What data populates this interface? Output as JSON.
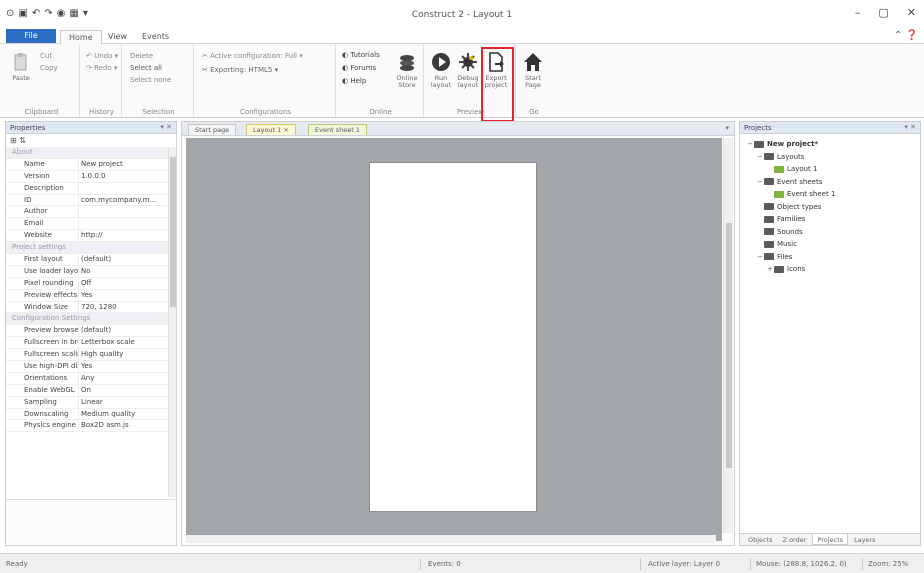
{
  "window": {
    "title": "Construct 2 - Layout 1",
    "controls": [
      "–",
      "▢",
      "✕"
    ]
  },
  "qat_icons": [
    "app-icon",
    "save-icon",
    "undo-icon",
    "redo-icon",
    "preview-icon",
    "settings-icon"
  ],
  "tabs": [
    {
      "label": "File"
    },
    {
      "label": "Home"
    },
    {
      "label": "View"
    },
    {
      "label": "Events"
    }
  ],
  "ribbon": {
    "clipboard": {
      "label": "Clipboard",
      "items": [
        "Paste",
        "Cut",
        "Copy",
        "Delete"
      ]
    },
    "history": {
      "label": "History",
      "items": [
        "Undo",
        "Redo"
      ]
    },
    "selection": {
      "label": "Selection",
      "items": [
        "Select all",
        "Select none"
      ]
    },
    "configurations": {
      "label": "Configurations",
      "items": [
        "Active configuration: Full",
        "Exporting: HTML5"
      ]
    },
    "online": {
      "label": "Online",
      "items": [
        "Tutorials",
        "Forums",
        "Help"
      ]
    },
    "store": {
      "label": "Online Store"
    },
    "preview": {
      "label": "Preview",
      "buttons": [
        {
          "label": "Run layout"
        },
        {
          "label": "Debug layout"
        },
        {
          "label": "Export project"
        }
      ]
    },
    "go": {
      "label": "Go",
      "buttons": [
        {
          "label": "Start Page"
        }
      ]
    }
  },
  "properties_panel": {
    "title": "Properties",
    "rows": [
      {
        "section": true,
        "key": "About"
      },
      {
        "key": "Name",
        "value": "New project"
      },
      {
        "key": "Version",
        "value": "1.0.0.0"
      },
      {
        "key": "Description",
        "value": ""
      },
      {
        "key": "ID",
        "value": "com.mycompany.m..."
      },
      {
        "key": "Author",
        "value": ""
      },
      {
        "key": "Email",
        "value": ""
      },
      {
        "key": "Website",
        "value": "http://"
      },
      {
        "section": true,
        "key": "Project settings"
      },
      {
        "key": "First layout",
        "value": "(default)"
      },
      {
        "key": "Use loader layout",
        "value": "No"
      },
      {
        "key": "Pixel rounding",
        "value": "Off"
      },
      {
        "key": "Preview effects",
        "value": "Yes"
      },
      {
        "key": "Window Size",
        "value": "720, 1280"
      },
      {
        "section": true,
        "key": "Configuration Settings"
      },
      {
        "key": "Preview browser",
        "value": "(default)"
      },
      {
        "key": "Fullscreen in brow...",
        "value": "Letterbox scale"
      },
      {
        "key": "Fullscreen scaling",
        "value": "High quality"
      },
      {
        "key": "Use high-DPI dis...",
        "value": "Yes"
      },
      {
        "key": "Orientations",
        "value": "Any"
      },
      {
        "key": "Enable WebGL",
        "value": "On"
      },
      {
        "key": "Sampling",
        "value": "Linear"
      },
      {
        "key": "Downscaling",
        "value": "Medium quality"
      },
      {
        "key": "Physics engine",
        "value": "Box2D asm.js"
      }
    ]
  },
  "doc_tabs": [
    {
      "label": "Start page"
    },
    {
      "label": "Layout 1 ×"
    },
    {
      "label": "Event sheet 1"
    }
  ],
  "projects_panel": {
    "title": "Projects",
    "tree": [
      {
        "label": "New project*",
        "depth": 0,
        "twisty": "−",
        "icon": "folder",
        "bold": true
      },
      {
        "label": "Layouts",
        "depth": 1,
        "twisty": "−",
        "icon": "folder"
      },
      {
        "label": "Layout 1",
        "depth": 2,
        "twisty": "",
        "icon": "layout"
      },
      {
        "label": "Event sheets",
        "depth": 1,
        "twisty": "−",
        "icon": "folder"
      },
      {
        "label": "Event sheet 1",
        "depth": 2,
        "twisty": "",
        "icon": "layout"
      },
      {
        "label": "Object types",
        "depth": 1,
        "twisty": "",
        "icon": "folder"
      },
      {
        "label": "Families",
        "depth": 1,
        "twisty": "",
        "icon": "folder"
      },
      {
        "label": "Sounds",
        "depth": 1,
        "twisty": "",
        "icon": "folder"
      },
      {
        "label": "Music",
        "depth": 1,
        "twisty": "",
        "icon": "folder"
      },
      {
        "label": "Files",
        "depth": 1,
        "twisty": "−",
        "icon": "folder"
      },
      {
        "label": "Icons",
        "depth": 2,
        "twisty": "+",
        "icon": "folder"
      }
    ],
    "bottom_tabs": [
      "Objects",
      "Z order",
      "Projects",
      "Layers"
    ],
    "active_bottom_tab": "Projects"
  },
  "status": {
    "left": "Ready",
    "events": "Events: 0",
    "layer": "Active layer: Layer 0",
    "mouse": "Mouse: (288.8, 1026.2, 0)",
    "zoom": "Zoom: 25%"
  }
}
